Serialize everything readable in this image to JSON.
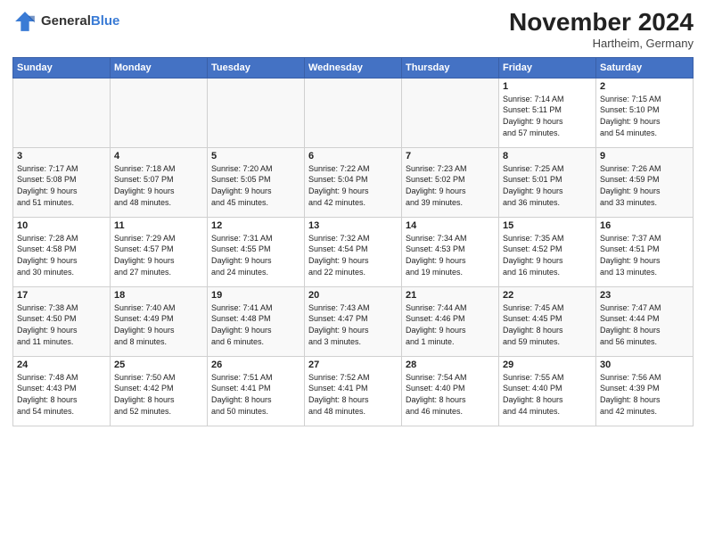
{
  "logo": {
    "text_general": "General",
    "text_blue": "Blue"
  },
  "header": {
    "month_title": "November 2024",
    "location": "Hartheim, Germany"
  },
  "days_of_week": [
    "Sunday",
    "Monday",
    "Tuesday",
    "Wednesday",
    "Thursday",
    "Friday",
    "Saturday"
  ],
  "weeks": [
    [
      {
        "day": "",
        "info": "",
        "empty": true
      },
      {
        "day": "",
        "info": "",
        "empty": true
      },
      {
        "day": "",
        "info": "",
        "empty": true
      },
      {
        "day": "",
        "info": "",
        "empty": true
      },
      {
        "day": "",
        "info": "",
        "empty": true
      },
      {
        "day": "1",
        "info": "Sunrise: 7:14 AM\nSunset: 5:11 PM\nDaylight: 9 hours\nand 57 minutes."
      },
      {
        "day": "2",
        "info": "Sunrise: 7:15 AM\nSunset: 5:10 PM\nDaylight: 9 hours\nand 54 minutes."
      }
    ],
    [
      {
        "day": "3",
        "info": "Sunrise: 7:17 AM\nSunset: 5:08 PM\nDaylight: 9 hours\nand 51 minutes."
      },
      {
        "day": "4",
        "info": "Sunrise: 7:18 AM\nSunset: 5:07 PM\nDaylight: 9 hours\nand 48 minutes."
      },
      {
        "day": "5",
        "info": "Sunrise: 7:20 AM\nSunset: 5:05 PM\nDaylight: 9 hours\nand 45 minutes."
      },
      {
        "day": "6",
        "info": "Sunrise: 7:22 AM\nSunset: 5:04 PM\nDaylight: 9 hours\nand 42 minutes."
      },
      {
        "day": "7",
        "info": "Sunrise: 7:23 AM\nSunset: 5:02 PM\nDaylight: 9 hours\nand 39 minutes."
      },
      {
        "day": "8",
        "info": "Sunrise: 7:25 AM\nSunset: 5:01 PM\nDaylight: 9 hours\nand 36 minutes."
      },
      {
        "day": "9",
        "info": "Sunrise: 7:26 AM\nSunset: 4:59 PM\nDaylight: 9 hours\nand 33 minutes."
      }
    ],
    [
      {
        "day": "10",
        "info": "Sunrise: 7:28 AM\nSunset: 4:58 PM\nDaylight: 9 hours\nand 30 minutes."
      },
      {
        "day": "11",
        "info": "Sunrise: 7:29 AM\nSunset: 4:57 PM\nDaylight: 9 hours\nand 27 minutes."
      },
      {
        "day": "12",
        "info": "Sunrise: 7:31 AM\nSunset: 4:55 PM\nDaylight: 9 hours\nand 24 minutes."
      },
      {
        "day": "13",
        "info": "Sunrise: 7:32 AM\nSunset: 4:54 PM\nDaylight: 9 hours\nand 22 minutes."
      },
      {
        "day": "14",
        "info": "Sunrise: 7:34 AM\nSunset: 4:53 PM\nDaylight: 9 hours\nand 19 minutes."
      },
      {
        "day": "15",
        "info": "Sunrise: 7:35 AM\nSunset: 4:52 PM\nDaylight: 9 hours\nand 16 minutes."
      },
      {
        "day": "16",
        "info": "Sunrise: 7:37 AM\nSunset: 4:51 PM\nDaylight: 9 hours\nand 13 minutes."
      }
    ],
    [
      {
        "day": "17",
        "info": "Sunrise: 7:38 AM\nSunset: 4:50 PM\nDaylight: 9 hours\nand 11 minutes."
      },
      {
        "day": "18",
        "info": "Sunrise: 7:40 AM\nSunset: 4:49 PM\nDaylight: 9 hours\nand 8 minutes."
      },
      {
        "day": "19",
        "info": "Sunrise: 7:41 AM\nSunset: 4:48 PM\nDaylight: 9 hours\nand 6 minutes."
      },
      {
        "day": "20",
        "info": "Sunrise: 7:43 AM\nSunset: 4:47 PM\nDaylight: 9 hours\nand 3 minutes."
      },
      {
        "day": "21",
        "info": "Sunrise: 7:44 AM\nSunset: 4:46 PM\nDaylight: 9 hours\nand 1 minute."
      },
      {
        "day": "22",
        "info": "Sunrise: 7:45 AM\nSunset: 4:45 PM\nDaylight: 8 hours\nand 59 minutes."
      },
      {
        "day": "23",
        "info": "Sunrise: 7:47 AM\nSunset: 4:44 PM\nDaylight: 8 hours\nand 56 minutes."
      }
    ],
    [
      {
        "day": "24",
        "info": "Sunrise: 7:48 AM\nSunset: 4:43 PM\nDaylight: 8 hours\nand 54 minutes."
      },
      {
        "day": "25",
        "info": "Sunrise: 7:50 AM\nSunset: 4:42 PM\nDaylight: 8 hours\nand 52 minutes."
      },
      {
        "day": "26",
        "info": "Sunrise: 7:51 AM\nSunset: 4:41 PM\nDaylight: 8 hours\nand 50 minutes."
      },
      {
        "day": "27",
        "info": "Sunrise: 7:52 AM\nSunset: 4:41 PM\nDaylight: 8 hours\nand 48 minutes."
      },
      {
        "day": "28",
        "info": "Sunrise: 7:54 AM\nSunset: 4:40 PM\nDaylight: 8 hours\nand 46 minutes."
      },
      {
        "day": "29",
        "info": "Sunrise: 7:55 AM\nSunset: 4:40 PM\nDaylight: 8 hours\nand 44 minutes."
      },
      {
        "day": "30",
        "info": "Sunrise: 7:56 AM\nSunset: 4:39 PM\nDaylight: 8 hours\nand 42 minutes."
      }
    ]
  ]
}
